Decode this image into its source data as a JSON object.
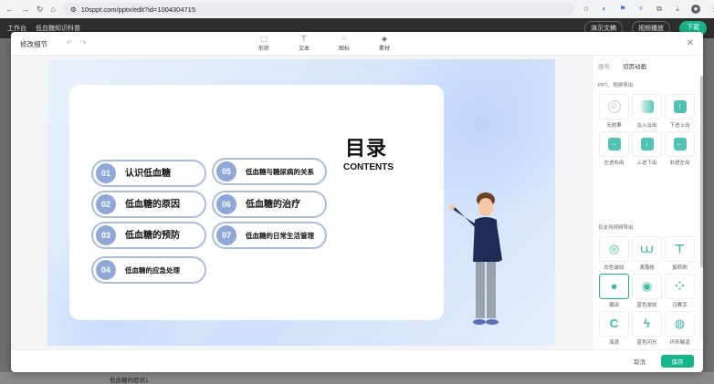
{
  "browser": {
    "url": "10sppt.com/pptx/edit?id=1004304715"
  },
  "app": {
    "back": "工作台",
    "doc_title": "低血糖知识科普",
    "preview": "演示文稿",
    "video": "视频播放",
    "download": "下载"
  },
  "modal": {
    "title": "修改细节",
    "tools": [
      {
        "label": "形状",
        "icon": "shape-icon"
      },
      {
        "label": "文本",
        "icon": "text-icon"
      },
      {
        "label": "图标",
        "icon": "grid-icon"
      },
      {
        "label": "素材",
        "icon": "material-icon"
      }
    ],
    "cancel": "取消",
    "save": "保存"
  },
  "slide": {
    "title": "目录",
    "subtitle": "CONTENTS",
    "items": [
      {
        "num": "01",
        "text": "认识低血糖"
      },
      {
        "num": "02",
        "text": "低血糖的原因"
      },
      {
        "num": "03",
        "text": "低血糖的预防"
      },
      {
        "num": "04",
        "text": "低血糖的应急处理"
      },
      {
        "num": "05",
        "text": "低血糖与糖尿病的关系"
      },
      {
        "num": "06",
        "text": "低血糖的治疗"
      },
      {
        "num": "07",
        "text": "低血糖的日常生活管理"
      }
    ]
  },
  "panel": {
    "tab_canvas": "画布",
    "tab_transition": "切页动画",
    "section1": "PPT、视频导出",
    "section1_items": [
      {
        "label": "无效果",
        "icon": "none-icon"
      },
      {
        "label": "淡入淡出",
        "icon": "fade-icon"
      },
      {
        "label": "下进上出",
        "icon": "arrow-up-icon"
      },
      {
        "label": "左进右出",
        "icon": "arrow-right-icon"
      },
      {
        "label": "上进下出",
        "icon": "arrow-down-icon"
      },
      {
        "label": "右进左出",
        "icon": "arrow-left-icon"
      }
    ],
    "section2": "仅支持视频导出",
    "section2_items": [
      {
        "label": "白色波纹",
        "icon": "ripple-icon"
      },
      {
        "label": "滴落帐",
        "icon": "drip-icon"
      },
      {
        "label": "旋转刷",
        "icon": "brush-icon"
      },
      {
        "label": "爆出",
        "icon": "burst-icon",
        "selected": true
      },
      {
        "label": "蓝色波纹",
        "icon": "blue-ripple-icon"
      },
      {
        "label": "马赛克",
        "icon": "mosaic-icon"
      },
      {
        "label": "海浪",
        "icon": "wave-icon"
      },
      {
        "label": "蓝色闪光",
        "icon": "flash-icon"
      },
      {
        "label": "环形隧道",
        "icon": "tunnel-icon"
      }
    ]
  },
  "background": {
    "bottom_text": "低血糖的症状1"
  },
  "colors": {
    "accent": "#16b58a",
    "pill_border": "#a9bde0",
    "pill_num": "#8fa8d8"
  }
}
